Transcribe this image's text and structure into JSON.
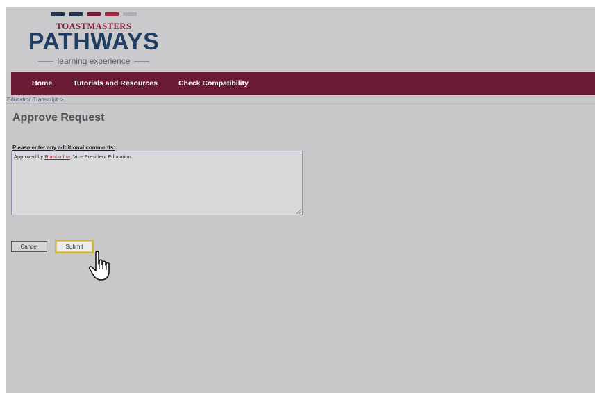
{
  "logo": {
    "dash_colors": [
      "#1f3550",
      "#1f3550",
      "#7a1b35",
      "#9c2a3c",
      "#a9b0b5"
    ],
    "top_text": "TOASTMASTERS",
    "top_color": "#8d1f3c",
    "main_text": "PATHWAYS",
    "main_color": "#1f3e62",
    "sub_text": "learning experience"
  },
  "nav": {
    "bg_color": "#6a1a33",
    "items": [
      "Home",
      "Tutorials and Resources",
      "Check Compatibility"
    ]
  },
  "breadcrumb": {
    "item": "Education Transcript",
    "separator": ">"
  },
  "page": {
    "title": "Approve Request",
    "comment_label": "Please enter any additional comments:",
    "comment_prefix": "Approved by ",
    "comment_name": "Rumbo Ina",
    "comment_suffix": ", Vice President Education."
  },
  "buttons": {
    "cancel": "Cancel",
    "submit": "Submit"
  },
  "cursor": {
    "icon": "hand-pointer-icon"
  }
}
